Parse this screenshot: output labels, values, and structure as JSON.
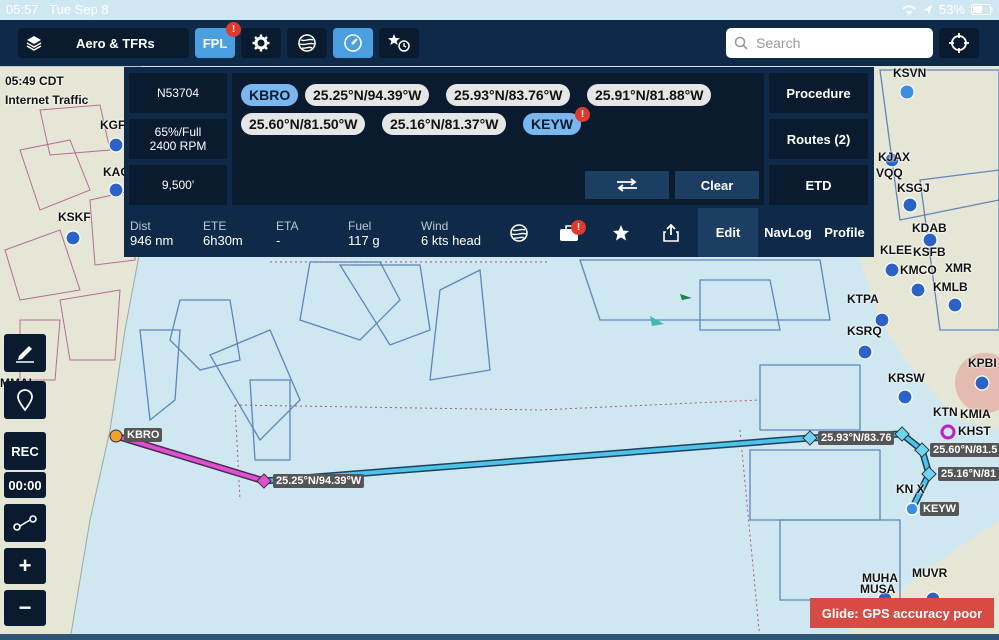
{
  "status": {
    "time": "05:57",
    "date": "Tue Sep 8",
    "battery": "53%"
  },
  "toolbar": {
    "layers_label": "Aero & TFRs",
    "fpl_label": "FPL",
    "fpl_badge": "!",
    "search_placeholder": "Search"
  },
  "panel": {
    "aircraft": "N53704",
    "power_line1": "65%/Full",
    "power_line2": "2400 RPM",
    "altitude": "9,500'",
    "waypoints": [
      {
        "label": "KBRO",
        "kind": "airport"
      },
      {
        "label": "25.25°N/94.39°W",
        "kind": "coord"
      },
      {
        "label": "25.93°N/83.76°W",
        "kind": "coord"
      },
      {
        "label": "25.91°N/81.88°W",
        "kind": "coord"
      },
      {
        "label": "25.60°N/81.50°W",
        "kind": "coord"
      },
      {
        "label": "25.16°N/81.37°W",
        "kind": "coord"
      },
      {
        "label": "KEYW",
        "kind": "airport"
      }
    ],
    "keyw_badge": "!",
    "procedure_label": "Procedure",
    "routes_label": "Routes (2)",
    "clear_label": "Clear",
    "etd_label": "ETD",
    "stats": [
      {
        "label": "Dist",
        "value": "946 nm"
      },
      {
        "label": "ETE",
        "value": "6h30m"
      },
      {
        "label": "ETA",
        "value": "-"
      },
      {
        "label": "Fuel",
        "value": "117 g"
      },
      {
        "label": "Wind",
        "value": "6 kts head"
      }
    ],
    "tabs": {
      "edit": "Edit",
      "navlog": "NavLog",
      "profile": "Profile"
    },
    "tools_badge": "!"
  },
  "sidebar": {
    "rec_label": "REC",
    "timer": "00:00",
    "plus": "+",
    "minus": "−"
  },
  "map": {
    "time_note": "05:49 CDT",
    "traffic_note": "Internet Traffic",
    "airports": [
      "KSKF",
      "KGF",
      "KAC",
      "KSVN",
      "KJAX",
      "VQQ",
      "KSGJ",
      "KDAB",
      "KLEE",
      "KSFB",
      "KMCO",
      "XMR",
      "KMLB",
      "KTPA",
      "KSRQ",
      "KRSW",
      "KTN",
      "KMIA",
      "KHST",
      "KPBI",
      "MUHA",
      "MUVR",
      "MUSA",
      "MMAL"
    ],
    "route_labels": [
      "KBRO",
      "25.25°N/94.39°W",
      "25.93°N/83.76",
      "25.60°N/81.5",
      "25.16°N/81",
      "KN X",
      "KEYW"
    ]
  },
  "alert": "Glide: GPS accuracy poor"
}
